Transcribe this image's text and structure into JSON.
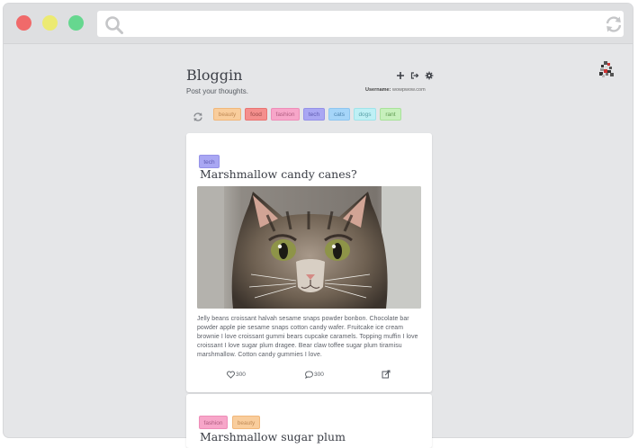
{
  "browser": {
    "url": "",
    "colors": {
      "close": "#f06a6a",
      "minimize": "#ecea72",
      "maximize": "#66d78f"
    }
  },
  "header": {
    "title": "Bloggin",
    "subtitle": "Post your thoughts.",
    "username_label": "Username:",
    "username_value": "wowpwow.com"
  },
  "filters": [
    {
      "label": "beauty",
      "color": "#f9cd9c"
    },
    {
      "label": "food",
      "color": "#f48f8d"
    },
    {
      "label": "fashion",
      "color": "#f7a6c9"
    },
    {
      "label": "tech",
      "color": "#a9a7f3"
    },
    {
      "label": "cats",
      "color": "#a5d5f9"
    },
    {
      "label": "dogs",
      "color": "#bef0f5"
    },
    {
      "label": "rant",
      "color": "#c7f0bc"
    }
  ],
  "posts": [
    {
      "tags": [
        "tech"
      ],
      "title": "Marshmallow candy canes?",
      "body": "Jelly beans croissant halvah sesame snaps powder bonbon. Chocolate bar powder apple pie sesame snaps cotton candy wafer. Fruitcake ice cream brownie I love croissant gummi bears cupcake caramels. Topping muffin I love croissant I love sugar plum dragee. Bear claw toffee sugar plum tiramisu marshmallow. Cotton candy gummies I love.",
      "likes": "300",
      "comments": "300"
    },
    {
      "tags": [
        "fashion",
        "beauty"
      ],
      "title": "Marshmallow sugar plum"
    }
  ]
}
